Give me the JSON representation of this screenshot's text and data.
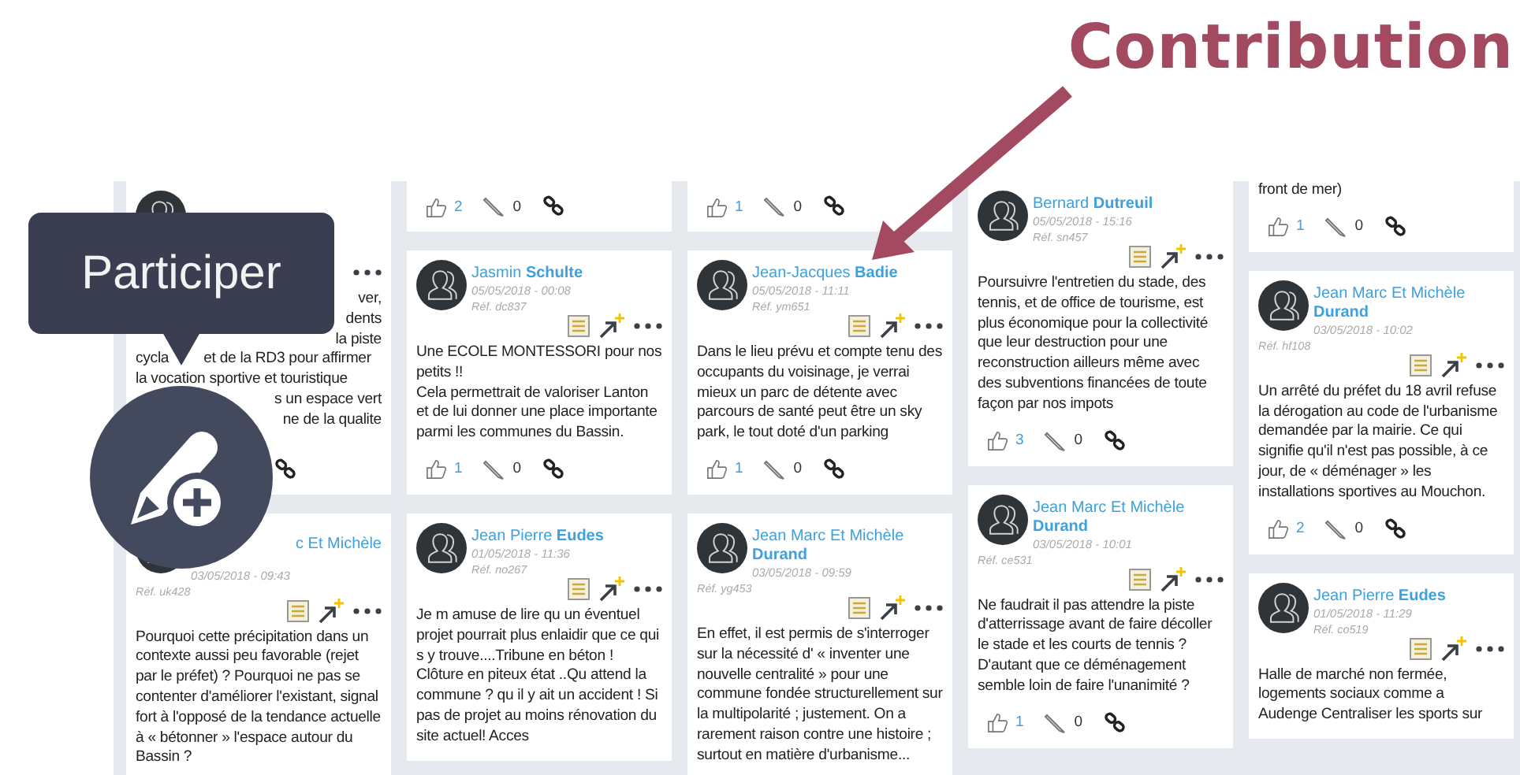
{
  "annotation": {
    "label": "Contribution"
  },
  "tooltip": {
    "label": "Participer"
  },
  "columns": [
    {
      "cards": [
        {
          "kind": "covered",
          "lines": [
            {
              "kind": "right",
              "parts": [
                "ver,"
              ]
            },
            {
              "kind": "right",
              "parts": [
                "dents"
              ]
            },
            {
              "kind": "right",
              "parts": [
                "la piste"
              ]
            },
            {
              "kind": "split",
              "parts": [
                "cycla",
                "et de la RD3 pour affirmer"
              ]
            },
            {
              "kind": "left",
              "parts": [
                "la vocation sportive et touristique"
              ]
            },
            {
              "kind": "right",
              "parts": [
                "s un espace vert"
              ]
            },
            {
              "kind": "right",
              "parts": [
                "ne de la qualite"
              ]
            }
          ]
        },
        {
          "kind": "overlapped",
          "author": "c Et Michèle",
          "date": "03/05/2018 - 09:43",
          "ref": "Réf. uk428",
          "text": "Pourquoi cette précipitation dans un contexte aussi peu favorable (rejet par le préfet) ? Pourquoi ne pas se contenter d'améliorer l'existant, signal fort à l'opposé de la tendance actuelle à « bétonner » l'espace autour du Bassin ?"
        }
      ]
    },
    {
      "cards": [
        {
          "kind": "tail",
          "likes": "2",
          "comments": "0"
        },
        {
          "kind": "full",
          "author": "Jasmin **Schulte**",
          "date": "05/05/2018 - 00:08",
          "ref": "Réf. dc837",
          "text": "Une ECOLE MONTESSORI pour nos petits !!\nCela permettrait de valoriser Lanton et de lui donner une place importante parmi les communes du Bassin.",
          "likes": "1",
          "comments": "0"
        },
        {
          "kind": "full",
          "author": "Jean Pierre **Eudes**",
          "date": "01/05/2018 - 11:36",
          "ref": "Réf. no267",
          "text": "Je m amuse de lire qu un éventuel projet pourrait plus enlaidir que ce qui s y trouve....Tribune en béton ! Clôture en piteux état ..Qu attend la commune ? qu il y ait un accident ! Si pas de projet au moins rénovation du site actuel! Acces"
        }
      ]
    },
    {
      "cards": [
        {
          "kind": "tail",
          "likes": "1",
          "comments": "0"
        },
        {
          "kind": "full",
          "author": "Jean-Jacques **Badie**",
          "date": "05/05/2018 - 11:11",
          "ref": "Réf. ym651",
          "text": "Dans le lieu prévu et compte tenu des occupants du voisinage, je verrai mieux un parc de détente avec parcours de santé peut être un sky park, le tout doté d'un parking",
          "likes": "1",
          "comments": "0"
        },
        {
          "kind": "full",
          "author": "Jean Marc Et Michèle **Durand**",
          "date": "03/05/2018 - 09:59",
          "ref": "Réf. yg453",
          "text": "En effet, il est permis de s'interroger sur la nécessité d' « inventer une nouvelle centralité » pour une commune fondée structurellement sur la multipolarité ; justement. On a rarement raison contre une histoire ; surtout en matière d'urbanisme..."
        }
      ]
    },
    {
      "cards": [
        {
          "kind": "full",
          "author": "Bernard **Dutreuil**",
          "date": "05/05/2018 - 15:16",
          "ref": "Réf. sn457",
          "text": "Poursuivre l'entretien du stade, des tennis, et de office de tourisme, est plus économique pour la collectivité que leur destruction pour une reconstruction ailleurs même avec des subventions financées de toute façon par nos impots",
          "likes": "3",
          "comments": "0"
        },
        {
          "kind": "full",
          "author": "Jean Marc Et Michèle **Durand**",
          "date": "03/05/2018 - 10:01",
          "ref": "Réf. ce531",
          "text": "Ne faudrait il pas attendre la piste d'atterrissage avant de faire décoller le stade et les courts de tennis ? D'autant que ce déménagement semble loin de faire l'unanimité ?",
          "likes": "1",
          "comments": "0"
        }
      ]
    },
    {
      "cards": [
        {
          "kind": "tail",
          "text": "front de mer)",
          "likes": "1",
          "comments": "0"
        },
        {
          "kind": "full",
          "author": "Jean Marc Et Michèle **Durand**",
          "date": "03/05/2018 - 10:02",
          "ref": "Réf. hf108",
          "text": "Un arrêté du préfet du 18 avril refuse la dérogation au code de l'urbanisme demandée par la mairie. Ce qui signifie qu'il n'est pas possible, à ce jour, de « déménager » les installations sportives au Mouchon.",
          "likes": "2",
          "comments": "0"
        },
        {
          "kind": "full",
          "author": "Jean Pierre **Eudes**",
          "date": "01/05/2018 - 11:29",
          "ref": "Réf. co519",
          "text": "Halle de marché non fermée, logements sociaux comme a Audenge Centraliser les sports sur"
        }
      ]
    }
  ]
}
